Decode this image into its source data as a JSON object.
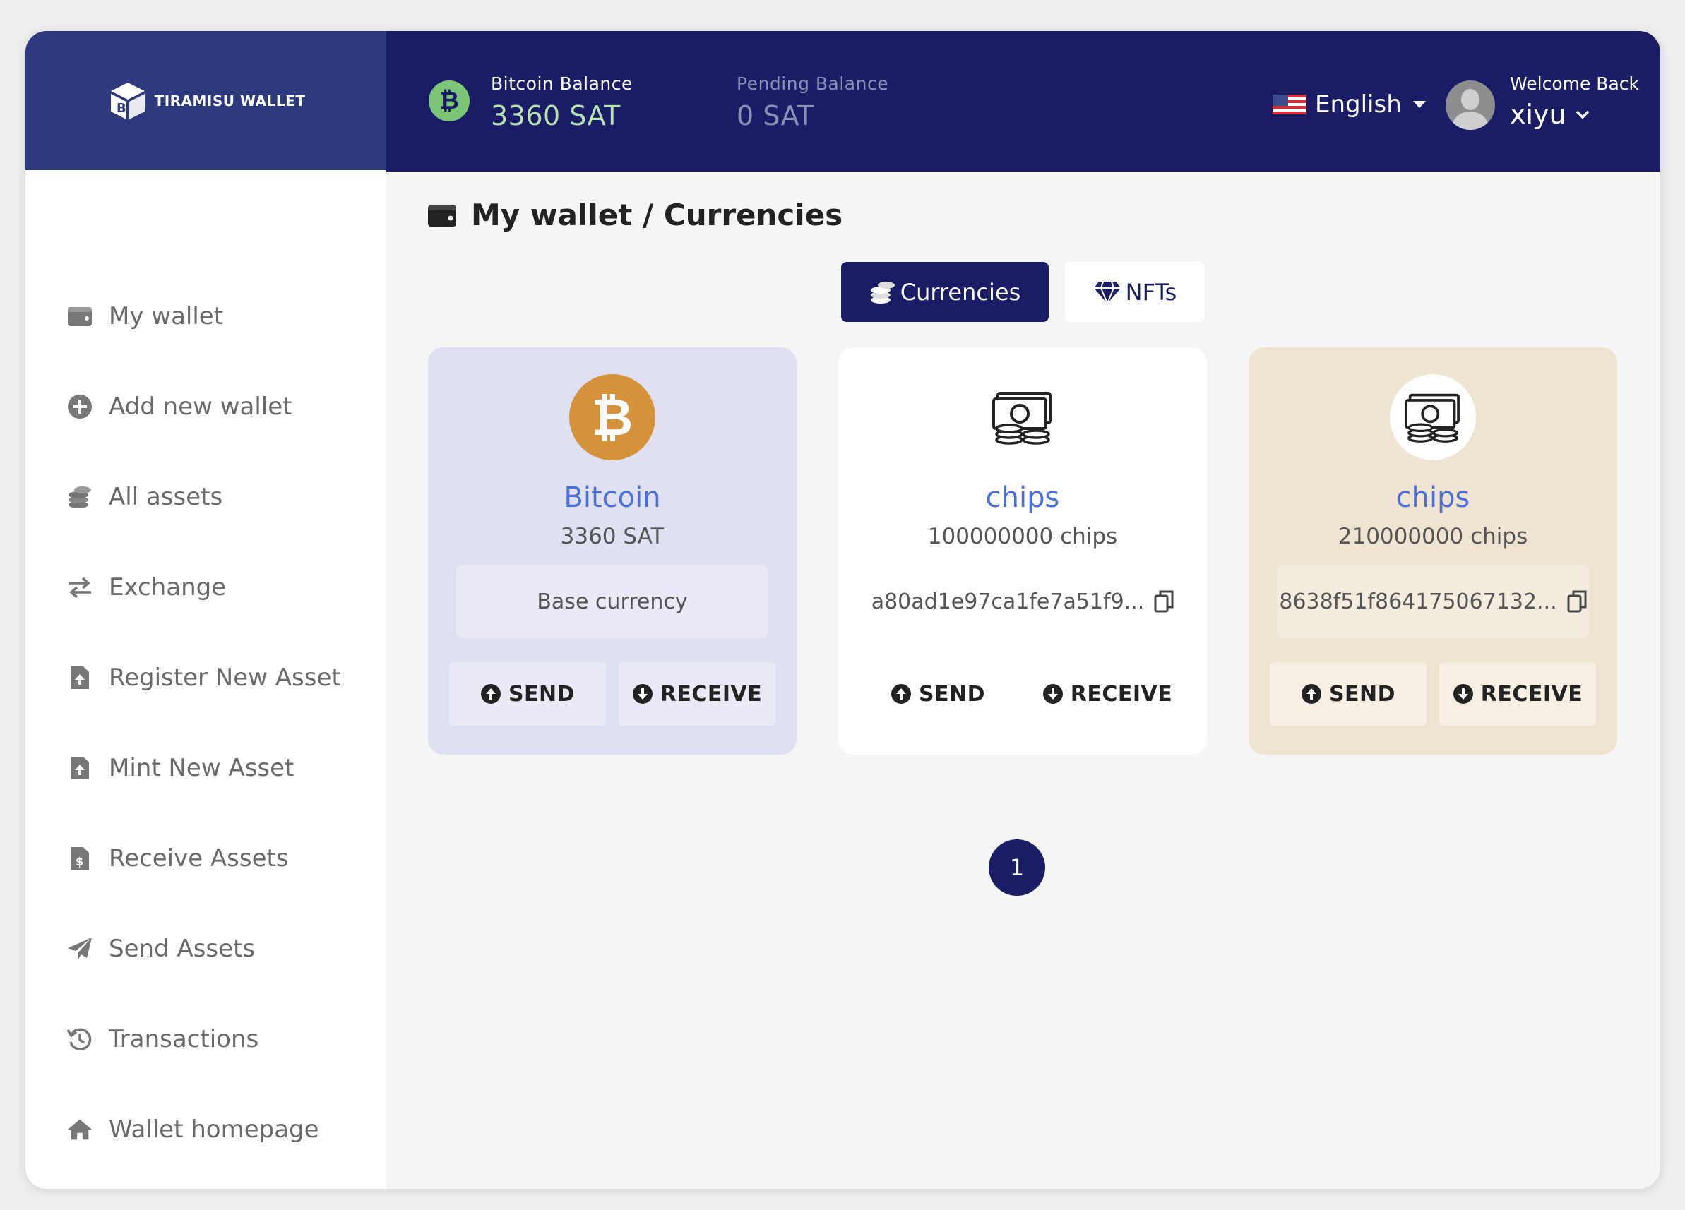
{
  "app": {
    "logo_text": "TIRAMISU WALLET"
  },
  "header": {
    "bitcoin_balance_label": "Bitcoin Balance",
    "bitcoin_balance_value": "3360 SAT",
    "pending_balance_label": "Pending Balance",
    "pending_balance_value": "0 SAT",
    "language": "English",
    "welcome": "Welcome Back",
    "username": "xiyu"
  },
  "sidebar": {
    "items": [
      {
        "label": "My wallet",
        "icon": "wallet-icon"
      },
      {
        "label": "Add new wallet",
        "icon": "plus-circle-icon"
      },
      {
        "label": "All assets",
        "icon": "coins-icon"
      },
      {
        "label": "Exchange",
        "icon": "exchange-icon"
      },
      {
        "label": "Register New Asset",
        "icon": "file-upload-icon"
      },
      {
        "label": "Mint New Asset",
        "icon": "file-upload-icon"
      },
      {
        "label": "Receive Assets",
        "icon": "file-invoice-dollar-icon"
      },
      {
        "label": "Send Assets",
        "icon": "paper-plane-icon"
      },
      {
        "label": "Transactions",
        "icon": "history-icon"
      },
      {
        "label": "Wallet homepage",
        "icon": "home-icon"
      }
    ]
  },
  "main": {
    "title": "My wallet / Currencies",
    "tabs": [
      {
        "label": "Currencies",
        "active": true
      },
      {
        "label": "NFTs",
        "active": false
      }
    ],
    "cards": [
      {
        "name": "Bitcoin",
        "amount": "3360 SAT",
        "info": "Base currency",
        "send": "SEND",
        "receive": "RECEIVE"
      },
      {
        "name": "chips",
        "amount": "100000000 chips",
        "info": "a80ad1e97ca1fe7a51f9...",
        "send": "SEND",
        "receive": "RECEIVE"
      },
      {
        "name": "chips",
        "amount": "210000000 chips",
        "info": "8638f51f864175067132...",
        "send": "SEND",
        "receive": "RECEIVE"
      }
    ],
    "pagination": {
      "current": "1"
    }
  },
  "colors": {
    "header_bg": "#1a1c65",
    "logo_bg": "#2f3a7e",
    "accent_link": "#4b6fd8",
    "bitcoin_orange": "#d4923a",
    "btc_card_bg": "#e0e0f3",
    "chips_card_bg": "#efe3d1"
  }
}
